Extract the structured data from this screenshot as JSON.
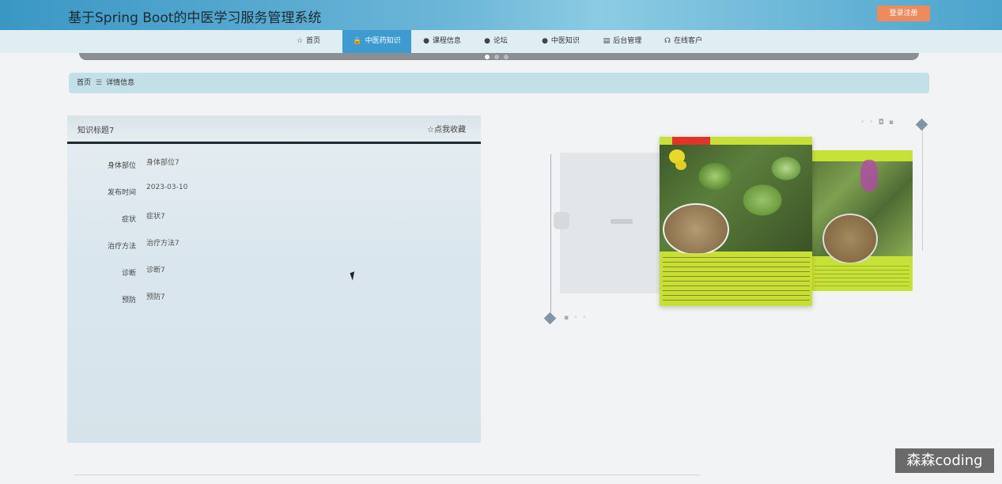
{
  "header": {
    "title": "基于Spring Boot的中医学习服务管理系统",
    "login_label": "登录注册"
  },
  "nav": {
    "items": [
      {
        "label": "首页",
        "icon": "☆"
      },
      {
        "label": "中医药知识",
        "icon": "🔒"
      },
      {
        "label": "课程信息",
        "icon": "●"
      },
      {
        "label": "论坛",
        "icon": "●"
      },
      {
        "label": "中医知识",
        "icon": "●"
      },
      {
        "label": "后台管理",
        "icon": "▤"
      },
      {
        "label": "在线客户",
        "icon": "☊"
      }
    ],
    "active_index": 1
  },
  "breadcrumb": {
    "home": "首页",
    "separator": "☰",
    "current": "详情信息"
  },
  "detail": {
    "title": "知识标题7",
    "favorite_label": "☆点我收藏",
    "fields": [
      {
        "label": "身体部位",
        "value": "身体部位7"
      },
      {
        "label": "发布时间",
        "value": "2023-03-10"
      },
      {
        "label": "症状",
        "value": "症状7"
      },
      {
        "label": "治疗方法",
        "value": "治疗方法7"
      },
      {
        "label": "诊断",
        "value": "诊断7"
      },
      {
        "label": "预防",
        "value": "预防7"
      }
    ]
  },
  "watermark": "森森coding",
  "colors": {
    "header": "#4ba3cc",
    "nav_active": "#3e9bd1",
    "login_button": "#ee8a5c",
    "card_green": "#c8df35"
  }
}
